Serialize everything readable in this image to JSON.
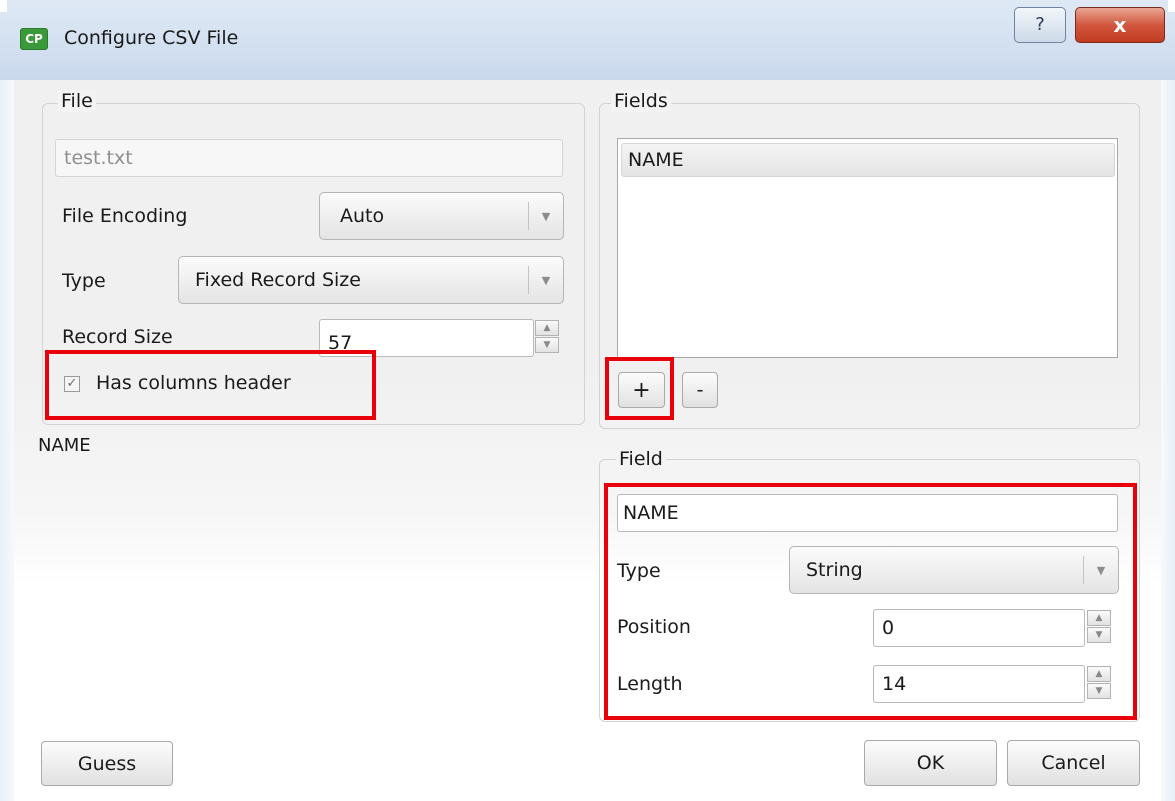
{
  "window": {
    "title": "Configure CSV File",
    "app_icon_text": "CP",
    "help_label": "?",
    "close_label": "x"
  },
  "file_group": {
    "title": "File",
    "filename": "test.txt",
    "encoding_label": "File Encoding",
    "encoding_value": "Auto",
    "type_label": "Type",
    "type_value": "Fixed Record Size",
    "record_size_label": "Record Size",
    "record_size_value": "57",
    "has_header_label": "Has columns header",
    "has_header_checked": true
  },
  "preview_text": "NAME",
  "fields_group": {
    "title": "Fields",
    "items": [
      "NAME"
    ],
    "add_label": "+",
    "remove_label": "-"
  },
  "field_group": {
    "title": "Field",
    "name_value": "NAME",
    "type_label": "Type",
    "type_value": "String",
    "position_label": "Position",
    "position_value": "0",
    "length_label": "Length",
    "length_value": "14"
  },
  "buttons": {
    "guess": "Guess",
    "ok": "OK",
    "cancel": "Cancel"
  },
  "colors": {
    "highlight": "#e8000b"
  }
}
